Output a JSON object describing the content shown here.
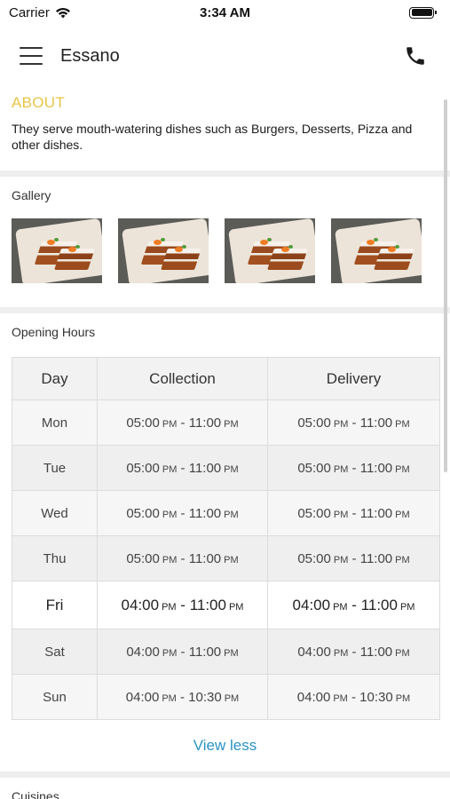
{
  "status_bar": {
    "carrier": "Carrier",
    "time": "3:34 AM"
  },
  "nav": {
    "title": "Essano"
  },
  "about": {
    "title": "ABOUT",
    "text": "They serve mouth-watering dishes such as Burgers, Desserts, Pizza and other dishes."
  },
  "gallery": {
    "title": "Gallery",
    "image_count": 4
  },
  "opening_hours": {
    "title": "Opening Hours",
    "headers": [
      "Day",
      "Collection",
      "Delivery"
    ],
    "rows": [
      {
        "day": "Mon",
        "collection": {
          "start": "05:00",
          "start_ampm": "PM",
          "end": "11:00",
          "end_ampm": "PM"
        },
        "delivery": {
          "start": "05:00",
          "start_ampm": "PM",
          "end": "11:00",
          "end_ampm": "PM"
        }
      },
      {
        "day": "Tue",
        "collection": {
          "start": "05:00",
          "start_ampm": "PM",
          "end": "11:00",
          "end_ampm": "PM"
        },
        "delivery": {
          "start": "05:00",
          "start_ampm": "PM",
          "end": "11:00",
          "end_ampm": "PM"
        }
      },
      {
        "day": "Wed",
        "collection": {
          "start": "05:00",
          "start_ampm": "PM",
          "end": "11:00",
          "end_ampm": "PM"
        },
        "delivery": {
          "start": "05:00",
          "start_ampm": "PM",
          "end": "11:00",
          "end_ampm": "PM"
        }
      },
      {
        "day": "Thu",
        "collection": {
          "start": "05:00",
          "start_ampm": "PM",
          "end": "11:00",
          "end_ampm": "PM"
        },
        "delivery": {
          "start": "05:00",
          "start_ampm": "PM",
          "end": "11:00",
          "end_ampm": "PM"
        }
      },
      {
        "day": "Fri",
        "today": true,
        "collection": {
          "start": "04:00",
          "start_ampm": "PM",
          "end": "11:00",
          "end_ampm": "PM"
        },
        "delivery": {
          "start": "04:00",
          "start_ampm": "PM",
          "end": "11:00",
          "end_ampm": "PM"
        }
      },
      {
        "day": "Sat",
        "collection": {
          "start": "04:00",
          "start_ampm": "PM",
          "end": "11:00",
          "end_ampm": "PM"
        },
        "delivery": {
          "start": "04:00",
          "start_ampm": "PM",
          "end": "11:00",
          "end_ampm": "PM"
        }
      },
      {
        "day": "Sun",
        "collection": {
          "start": "04:00",
          "start_ampm": "PM",
          "end": "10:30",
          "end_ampm": "PM"
        },
        "delivery": {
          "start": "04:00",
          "start_ampm": "PM",
          "end": "10:30",
          "end_ampm": "PM"
        }
      }
    ],
    "toggle_label": "View less"
  },
  "cuisines": {
    "title": "Cuisines"
  },
  "colors": {
    "accent": "#e8c547",
    "link": "#2a93c4",
    "divider": "#eeeeee"
  }
}
